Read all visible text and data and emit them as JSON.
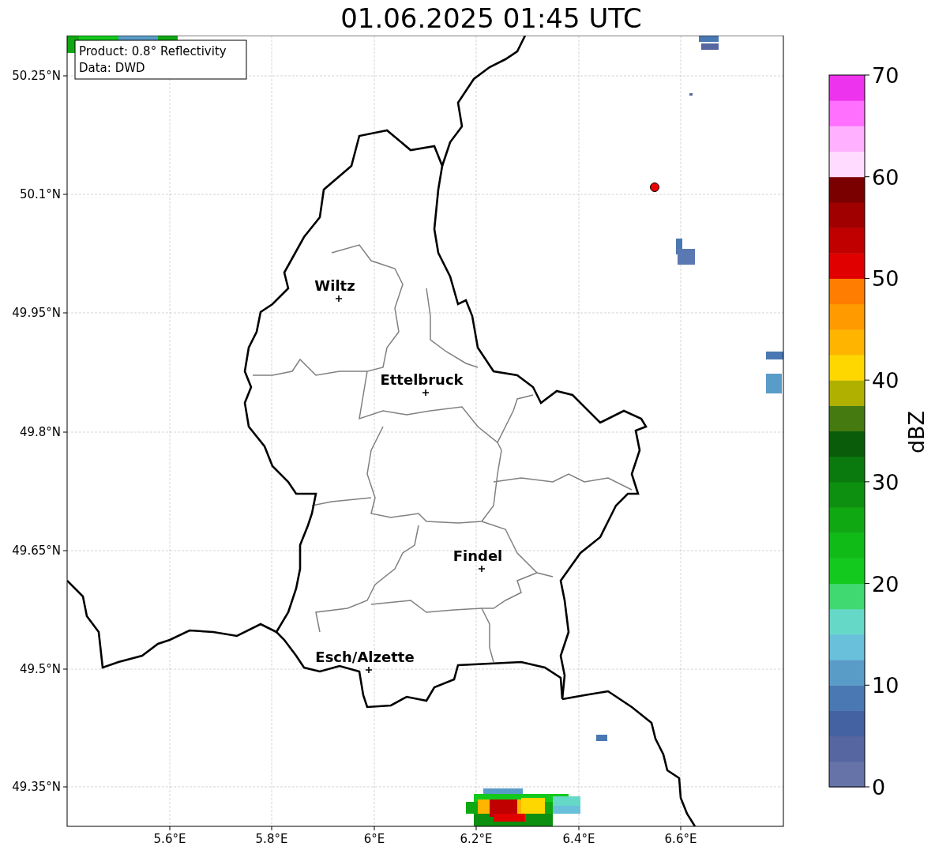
{
  "title": "01.06.2025 01:45 UTC",
  "legend": [
    "Product: 0.8° Reflectivity",
    "Data: DWD"
  ],
  "cities": [
    {
      "name": "Wiltz"
    },
    {
      "name": "Ettelbruck"
    },
    {
      "name": "Findel"
    },
    {
      "name": "Esch/Alzette"
    }
  ],
  "y_ticks": [
    "50.25°N",
    "50.1°N",
    "49.95°N",
    "49.8°N",
    "49.65°N",
    "49.5°N",
    "49.35°N"
  ],
  "x_ticks": [
    "5.6°E",
    "5.8°E",
    "6°E",
    "6.2°E",
    "6.4°E",
    "6.6°E"
  ],
  "colorbar": {
    "label": "dBZ",
    "ticks": [
      "70",
      "60",
      "50",
      "40",
      "30",
      "20",
      "10",
      "0"
    ]
  }
}
